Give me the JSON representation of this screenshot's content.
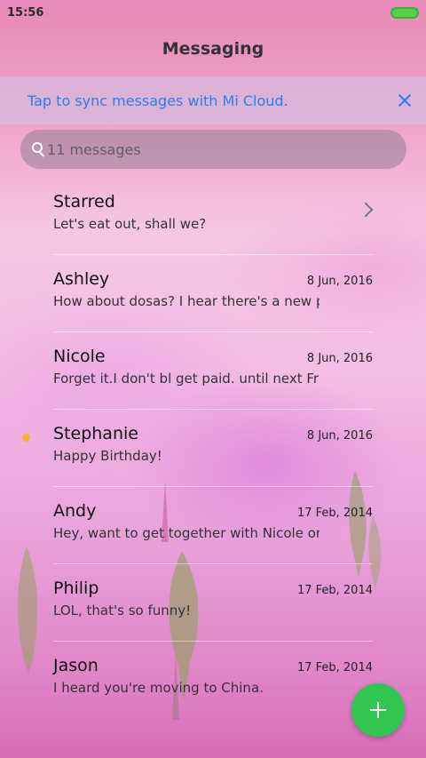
{
  "status_bar": {
    "time": "15:56"
  },
  "header": {
    "title": "Messaging"
  },
  "sync_banner": {
    "text": "Tap to sync messages with Mi Cloud."
  },
  "search": {
    "placeholder": "11 messages"
  },
  "conversations": [
    {
      "name": "Starred",
      "snippet": "Let's eat out, shall we?",
      "date": ""
    },
    {
      "name": "Ashley",
      "snippet": "How about dosas? I hear there's a new p…",
      "date": "8 Jun, 2016"
    },
    {
      "name": "Nicole",
      "snippet": "Forget it.I don't bl get paid. until next Fri…",
      "date": "8 Jun, 2016"
    },
    {
      "name": "Stephanie",
      "snippet": "Happy Birthday!",
      "date": "8 Jun, 2016",
      "unread": true
    },
    {
      "name": "Andy",
      "snippet": "Hey, want to get together with Nicole on…",
      "date": "17 Feb, 2014"
    },
    {
      "name": "Philip",
      "snippet": "LOL, that's so funny!",
      "date": "17 Feb, 2014"
    },
    {
      "name": "Jason",
      "snippet": "I heard you're moving to China.",
      "date": "17 Feb, 2014"
    }
  ],
  "colors": {
    "accent": "#2b7ff0",
    "fab": "#33c452",
    "unread_dot": "#f4b23a",
    "battery": "#57d047"
  },
  "icons": {
    "search": "search-icon",
    "close": "close-icon",
    "chevron": "chevron-right-icon",
    "compose": "plus-icon"
  }
}
